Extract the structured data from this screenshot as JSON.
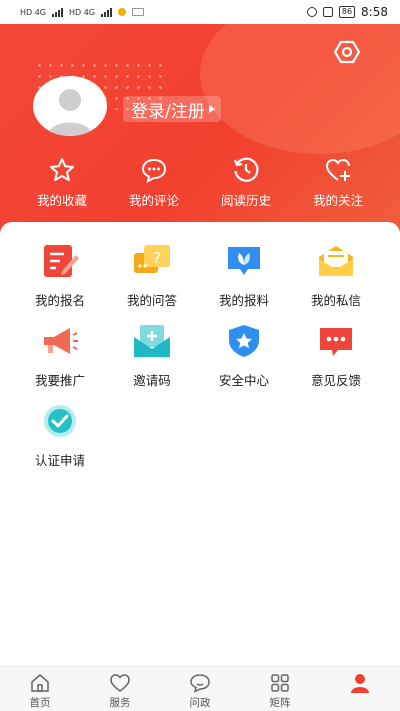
{
  "status_bar": {
    "left_network_1": "HD 4G",
    "left_network_2": "HD 4G",
    "battery": "86",
    "time": "8:58"
  },
  "profile": {
    "login_label": "登录/注册"
  },
  "quick_actions": [
    {
      "label": "我的收藏",
      "icon": "star-icon"
    },
    {
      "label": "我的评论",
      "icon": "comment-icon"
    },
    {
      "label": "阅读历史",
      "icon": "history-icon"
    },
    {
      "label": "我的关注",
      "icon": "heart-plus-icon"
    }
  ],
  "grid": [
    {
      "label": "我的报名",
      "icon": "signup-icon"
    },
    {
      "label": "我的问答",
      "icon": "qa-icon"
    },
    {
      "label": "我的报料",
      "icon": "report-icon"
    },
    {
      "label": "我的私信",
      "icon": "mail-icon"
    },
    {
      "label": "我要推广",
      "icon": "megaphone-icon"
    },
    {
      "label": "邀请码",
      "icon": "invite-code-icon"
    },
    {
      "label": "安全中心",
      "icon": "shield-star-icon"
    },
    {
      "label": "意见反馈",
      "icon": "feedback-icon"
    },
    {
      "label": "认证申请",
      "icon": "certification-icon"
    }
  ],
  "tabs": [
    {
      "label": "首页",
      "icon": "home-icon"
    },
    {
      "label": "服务",
      "icon": "service-heart-icon"
    },
    {
      "label": "问政",
      "icon": "question-bubble-icon"
    },
    {
      "label": "矩阵",
      "icon": "grid-icon"
    },
    {
      "label": "",
      "icon": "profile-icon"
    }
  ],
  "colors": {
    "header_red": "#f2402f",
    "accent": "#f0402f"
  }
}
